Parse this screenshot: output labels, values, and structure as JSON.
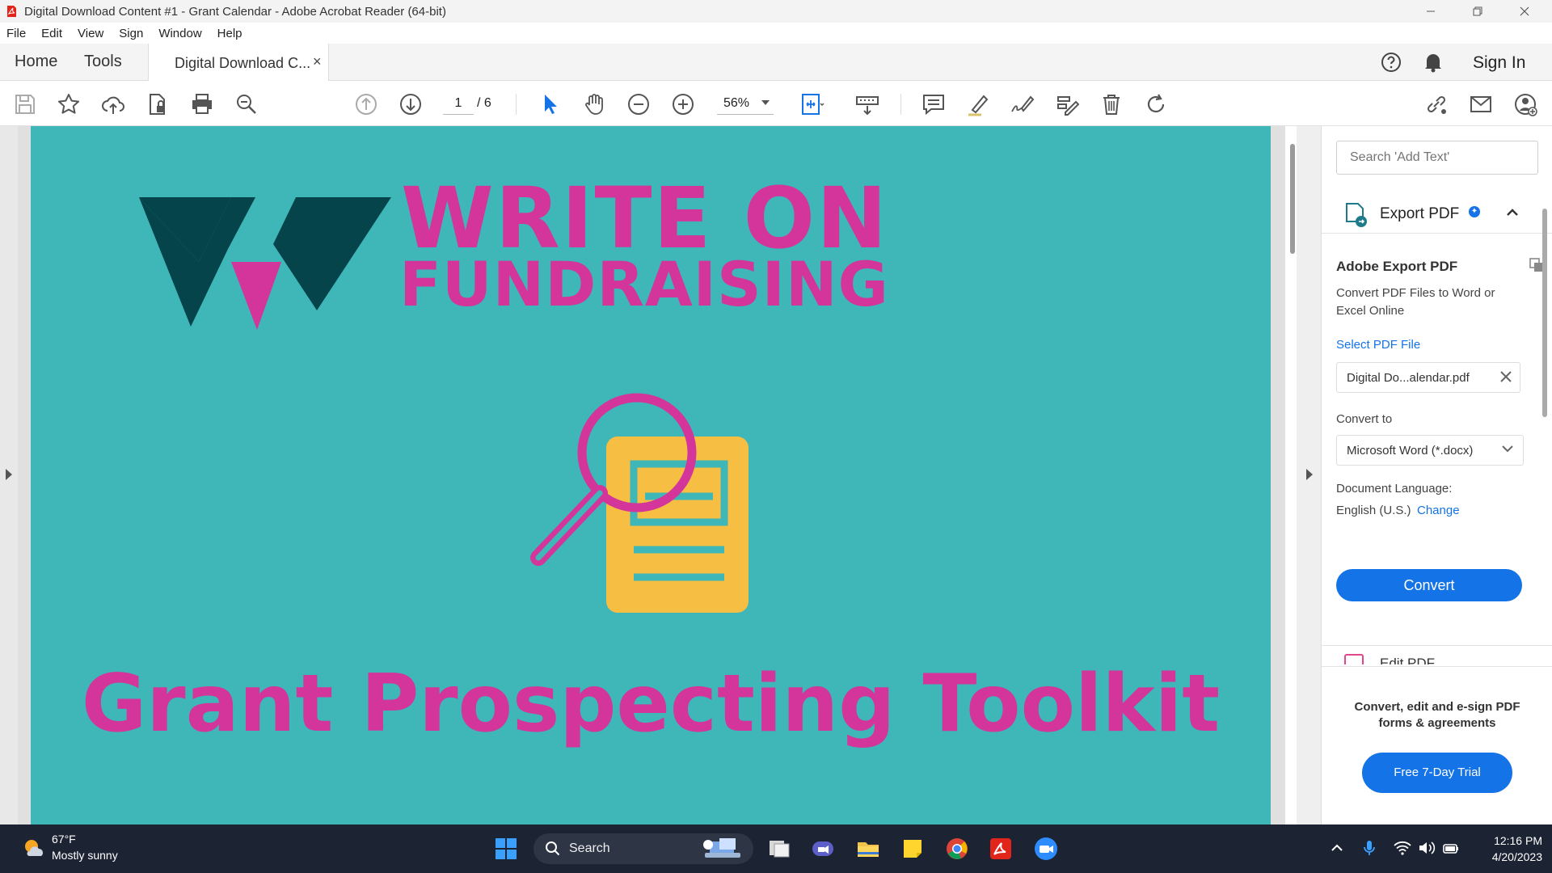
{
  "window": {
    "title": "Digital Download Content #1 - Grant Calendar - Adobe Acrobat Reader (64-bit)"
  },
  "menu": {
    "items": [
      "File",
      "Edit",
      "View",
      "Sign",
      "Window",
      "Help"
    ]
  },
  "tabs": {
    "home": "Home",
    "tools": "Tools",
    "document": "Digital Download C...",
    "close": "×",
    "sign_in": "Sign In"
  },
  "toolbar": {
    "page_current": "1",
    "page_total": "/ 6",
    "zoom": "56%"
  },
  "document": {
    "headline_line1": "WRITE ON",
    "headline_line2": "FUNDRAISING",
    "subtitle": "Grant Prospecting Toolkit",
    "colors": {
      "background": "#3fb6b7",
      "magenta": "#d3359a",
      "dark_teal": "#05444a",
      "yellow": "#f6be43"
    }
  },
  "right_panel": {
    "search_placeholder": "Search 'Add Text'",
    "export_title": "Export PDF",
    "adobe_export_title": "Adobe Export PDF",
    "adobe_export_desc": "Convert PDF Files to Word or Excel Online",
    "select_pdf": "Select PDF File",
    "file_name": "Digital Do...alendar.pdf",
    "convert_to_label": "Convert to",
    "convert_to_value": "Microsoft Word (*.docx)",
    "doc_language_label": "Document Language:",
    "doc_language_value": "English (U.S.)",
    "change": "Change",
    "convert_button": "Convert",
    "edit_pdf": "Edit PDF",
    "promo_text": "Convert, edit and e-sign PDF forms & agreements",
    "trial_button": "Free 7-Day Trial"
  },
  "taskbar": {
    "temperature": "67°F",
    "weather": "Mostly sunny",
    "search": "Search",
    "time": "12:16 PM",
    "date": "4/20/2023"
  }
}
